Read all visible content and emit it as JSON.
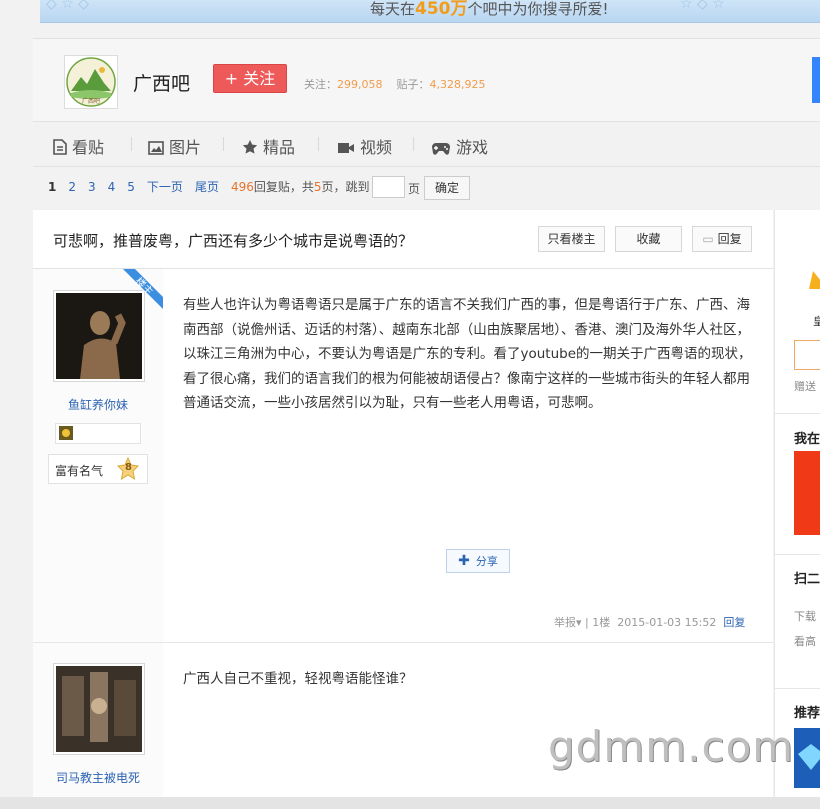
{
  "banner": {
    "text_pre": "每天在",
    "text_highlight": "450万",
    "text_post": "个吧中为你搜寻所爱!"
  },
  "forum": {
    "name": "广西吧",
    "follow_label": "+ 关注",
    "followers_label": "关注：",
    "followers": "299,058",
    "posts_label": "贴子：",
    "posts": "4,328,925"
  },
  "tabs": [
    {
      "label": "看贴",
      "icon": "document-icon"
    },
    {
      "label": "图片",
      "icon": "picture-icon"
    },
    {
      "label": "精品",
      "icon": "star-icon"
    },
    {
      "label": "视频",
      "icon": "video-icon"
    },
    {
      "label": "游戏",
      "icon": "gamepad-icon"
    }
  ],
  "pager": {
    "current": "1",
    "pages": [
      "2",
      "3",
      "4",
      "5"
    ],
    "next": "下一页",
    "last": "尾页",
    "reply_count": "496",
    "reply_suffix": "回复贴，共",
    "total_pages": "5",
    "page_suffix": "页，跳到",
    "jump_unit": "页",
    "confirm": "确定"
  },
  "thread": {
    "title": "可悲啊，推普废粤，广西还有多少个城市是说粤语的？",
    "only_op": "只看楼主",
    "favorite": "收藏",
    "reply": "回复"
  },
  "posts": [
    {
      "badge": "楼主",
      "username": "鱼缸养你妹",
      "level": "8",
      "rank": "富有名气",
      "content": "有些人也许认为粤语粤语只是属于广东的语言不关我们广西的事，但是粤语行于广东、广西、海南西部（说儋州话、迈话的村落）、越南东北部（山由族聚居地）、香港、澳门及海外华人社区，以珠江三角洲为中心，不要认为粤语是广东的专利。看了youtube的一期关于广西粤语的现状，看了很心痛，我们的语言我们的根为何能被胡语侵占？像南宁这样的一些城市街头的年轻人都用普通话交流，一些小孩居然引以为耻，只有一些老人用粤语，可悲啊。",
      "share": "分享",
      "report": "举报",
      "floor": "1楼",
      "time": "2015-01-03 15:52",
      "reply": "回复"
    },
    {
      "username": "司马教主被电死",
      "content": "广西人自己不重视，轻视粤语能怪谁？"
    }
  ],
  "right": {
    "heading1": "我在",
    "heading2": "扫二",
    "line1": "下载",
    "line2": "看高",
    "heading3": "推荐",
    "gift_label": "赠送",
    "partial_char": "皇"
  },
  "watermark": "gdmm.com",
  "colors": {
    "accent_blue": "#2d64b3",
    "follow_red": "#ee5a5a",
    "stat_orange": "#f29c4b",
    "louzhu_badge": "#3b8ee0"
  }
}
